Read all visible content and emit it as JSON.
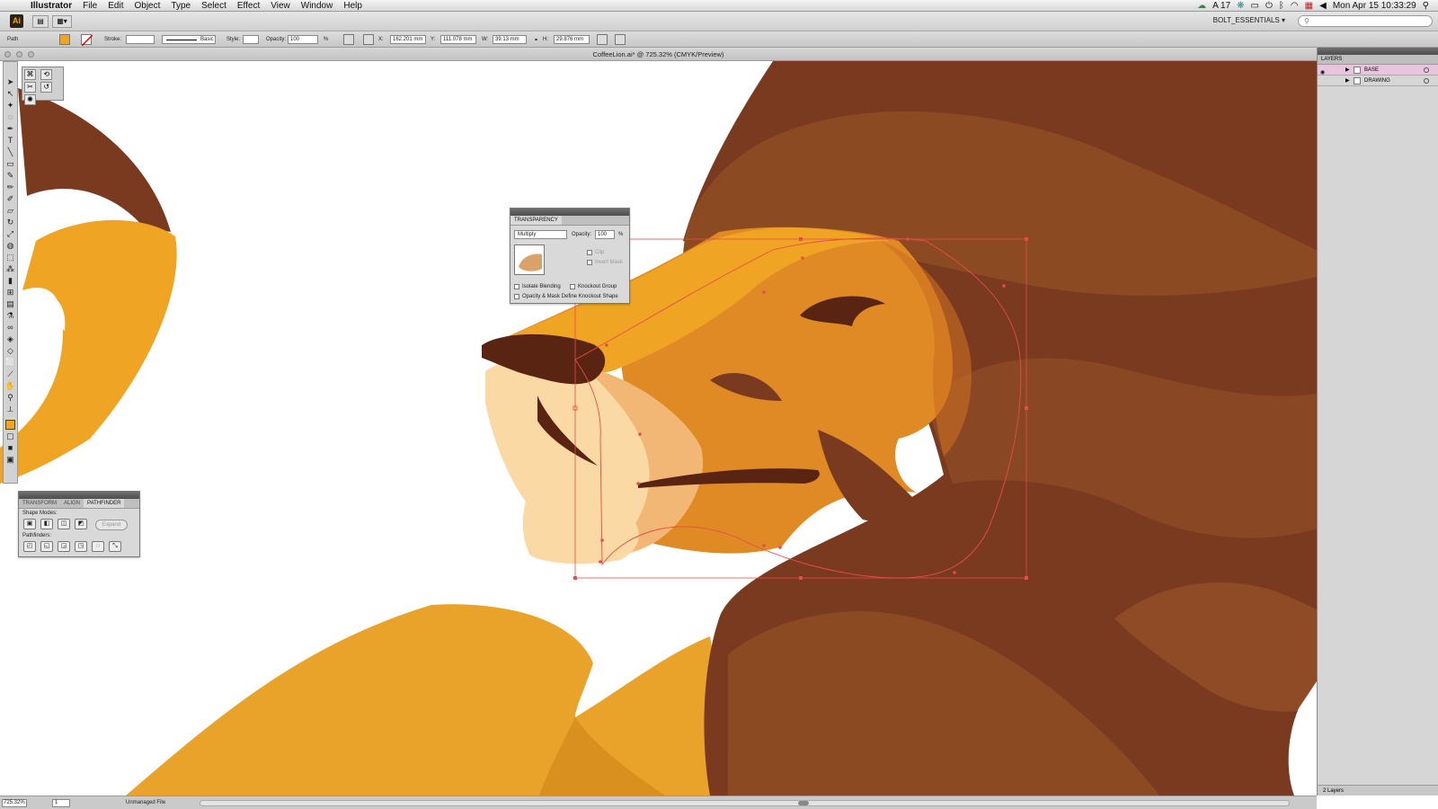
{
  "menubar": {
    "app_name": "Illustrator",
    "menus": [
      "File",
      "Edit",
      "Object",
      "Type",
      "Select",
      "Effect",
      "View",
      "Window",
      "Help"
    ],
    "status_count": "17",
    "clock": "Mon Apr 15  10:33:29"
  },
  "appbar": {
    "logo": "Ai",
    "workspace": "BOLT_ESSENTIALS ▾"
  },
  "controlbar": {
    "selection_type": "Path",
    "stroke_label": "Stroke:",
    "brush_label": "Basic",
    "style_label": "Style:",
    "opacity_label": "Opacity:",
    "opacity_value": "100",
    "opacity_unit": "%",
    "x_label": "X:",
    "x_value": "162.201 mm",
    "y_label": "Y:",
    "y_value": "111.078 mm",
    "w_label": "W:",
    "w_value": "39.13 mm",
    "h_label": "H:",
    "h_value": "29.876 mm"
  },
  "document": {
    "title": "CoffeeLion.ai* @ 725.32% (CMYK/Preview)"
  },
  "transparency_panel": {
    "tab": "TRANSPARENCY",
    "blend_mode": "Multiply",
    "opacity_label": "Opacity:",
    "opacity_value": "100",
    "opacity_unit": "%",
    "clip_label": "Clip",
    "invert_mask_label": "Invert Mask",
    "isolate_blending_label": "Isolate Blending",
    "knockout_group_label": "Knockout Group",
    "opacity_mask_label": "Opacity & Mask Define Knockout Shape"
  },
  "pathfinder_panel": {
    "tabs": [
      "TRANSFORM",
      "ALIGN",
      "PATHFINDER"
    ],
    "shape_modes_label": "Shape Modes:",
    "expand_label": "Expand",
    "pathfinders_label": "Pathfinders:"
  },
  "layers_panel": {
    "tab": "LAYERS",
    "layers": [
      {
        "name": "BASE",
        "selected": true
      },
      {
        "name": "DRAWING",
        "selected": false
      }
    ],
    "footer": "2 Layers"
  },
  "statusbar": {
    "zoom": "725.32%",
    "page": "1",
    "file_status": "Unmanaged File"
  },
  "colors": {
    "mane_dark": "#7a3a1f",
    "mane_mid": "#8b4a22",
    "face_orange": "#e08a25",
    "gold": "#f0a424",
    "muzzle_light": "#fbd9a4",
    "muzzle_mid": "#f2b774",
    "feature_dark": "#5a2412",
    "selection": "#e74c4c",
    "layer_highlight": "#e8c4df"
  }
}
